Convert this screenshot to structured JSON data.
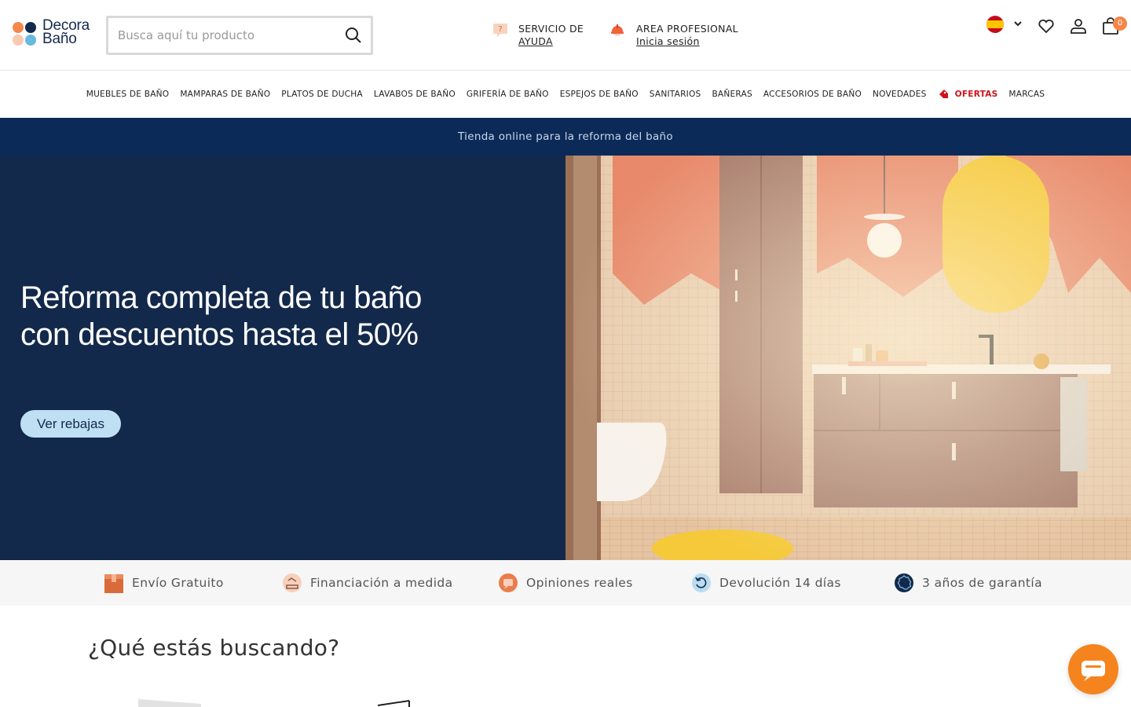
{
  "header": {
    "logo": {
      "line1": "Decora",
      "line2": "Baño"
    },
    "search": {
      "placeholder": "Busca aquí tu producto"
    },
    "help": {
      "line1": "SERVICIO DE",
      "link": "AYUDA"
    },
    "pro": {
      "line1": "AREA PROFESIONAL",
      "link": "Inicia sesión"
    },
    "cart_count": "0",
    "icons": [
      "spain-flag-icon",
      "chevron-down-icon",
      "heart-icon",
      "user-icon",
      "shopping-bag-icon"
    ]
  },
  "nav": {
    "items": [
      "MUEBLES DE BAÑO",
      "MAMPARAS DE BAÑO",
      "PLATOS DE DUCHA",
      "LAVABOS DE BAÑO",
      "GRIFERÍA DE BAÑO",
      "ESPEJOS DE BAÑO",
      "SANITARIOS",
      "BAÑERAS",
      "ACCESORIOS DE BAÑO",
      "NOVEDADES",
      "OFERTAS",
      "MARCAS"
    ],
    "sale_color": "#d0121b"
  },
  "strip": {
    "text": "Tienda online para la reforma del baño"
  },
  "hero": {
    "title": "Reforma completa de tu baño con descuentos hasta el 50%",
    "button": "Ver rebajas",
    "bg_color": "#13294b"
  },
  "benefits": [
    {
      "label": "Envío Gratuito",
      "icon": "box-icon"
    },
    {
      "label": "Financiación a medida",
      "icon": "financing-icon"
    },
    {
      "label": "Opiniones reales",
      "icon": "reviews-icon"
    },
    {
      "label": "Devolución 14 días",
      "icon": "return-icon"
    },
    {
      "label": "3 años de garantía",
      "icon": "warranty-icon"
    }
  ],
  "section": {
    "title": "¿Qué estás buscando?"
  },
  "colors": {
    "navy": "#0c2a58",
    "orange": "#f5841f",
    "light_blue": "#bfe0f3"
  }
}
